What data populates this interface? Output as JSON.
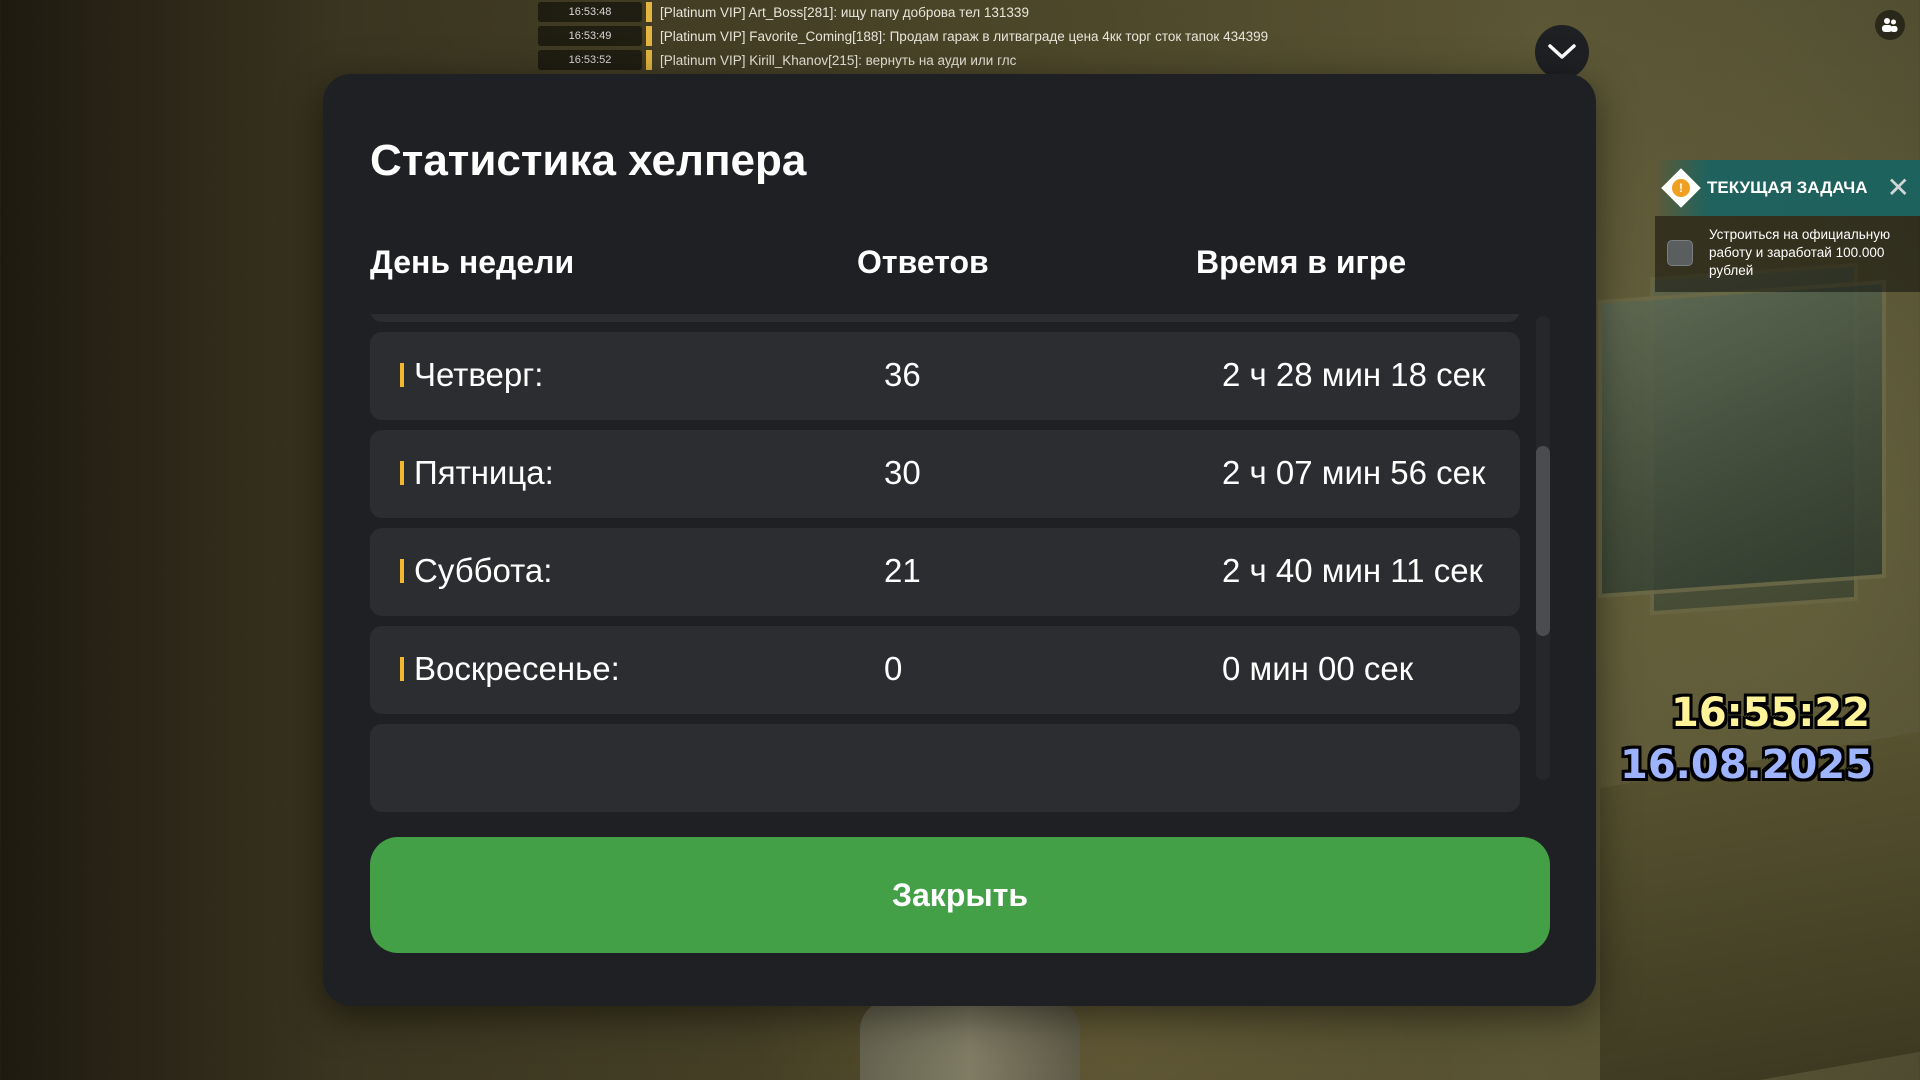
{
  "chat": [
    {
      "time": "16:53:48",
      "text": "[Platinum VIP] Art_Boss[281]: ищу папу доброва тел 131339",
      "dim": false
    },
    {
      "time": "16:53:49",
      "text": "[Platinum VIP] Favorite_Coming[188]: Продам гараж в литваграде цена 4кк торг сток тапок 434399",
      "dim": false
    },
    {
      "time": "16:53:52",
      "text": "[Platinum VIP] Kirill_Khanov[215]: вернуть на ауди или глс",
      "dim": false
    }
  ],
  "task": {
    "title": "ТЕКУЩАЯ ЗАДАЧА",
    "alert_glyph": "!",
    "close_glyph": "✕",
    "text": "Устроиться на официальную работу и заработай 100.000 рублей"
  },
  "clock": {
    "time": "16:55:22",
    "date": "16.08.2025"
  },
  "modal": {
    "title": "Статистика хелпера",
    "columns": [
      "День недели",
      "Ответов",
      "Время в игре"
    ],
    "rows": [
      {
        "day": "Четверг:",
        "answers": "36",
        "time": "2 ч 28 мин 18 сек"
      },
      {
        "day": "Пятница:",
        "answers": "30",
        "time": "2 ч 07 мин 56 сек"
      },
      {
        "day": "Суббота:",
        "answers": "21",
        "time": "2 ч 40 мин 11 сек"
      },
      {
        "day": "Воскресенье:",
        "answers": "0",
        "time": "0 мин 00 сек"
      }
    ],
    "close_label": "Закрыть"
  },
  "colors": {
    "accent_green": "#43a047",
    "row_marker": "#f2b72e",
    "modal_bg": "#1f2023",
    "row_bg": "#2c2d30"
  }
}
